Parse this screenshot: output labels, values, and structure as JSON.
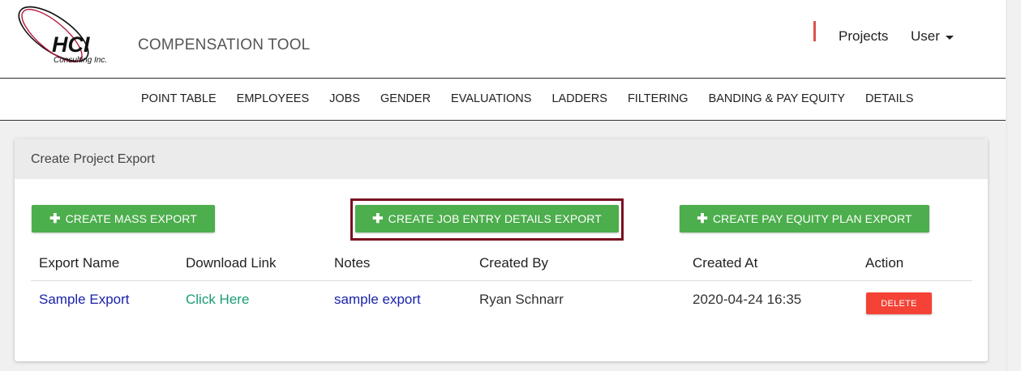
{
  "header": {
    "logo_main": "HCI",
    "logo_sub": "Consulting Inc.",
    "app_title": "COMPENSATION TOOL",
    "nav_projects": "Projects",
    "nav_user": "User"
  },
  "menu": {
    "items": [
      "POINT TABLE",
      "EMPLOYEES",
      "JOBS",
      "GENDER",
      "EVALUATIONS",
      "LADDERS",
      "FILTERING",
      "BANDING & PAY EQUITY",
      "DETAILS"
    ]
  },
  "card": {
    "title": "Create Project Export",
    "buttons": {
      "mass": "CREATE MASS EXPORT",
      "job": "CREATE JOB ENTRY DETAILS EXPORT",
      "pay": "CREATE PAY EQUITY PLAN EXPORT"
    },
    "table": {
      "headers": [
        "Export Name",
        "Download Link",
        "Notes",
        "Created By",
        "Created At",
        "Action"
      ],
      "rows": [
        {
          "export_name": "Sample Export",
          "download_link": "Click Here",
          "notes": "sample export",
          "created_by": "Ryan Schnarr",
          "created_at": "2020-04-24 16:35",
          "action": "DELETE"
        }
      ]
    }
  },
  "colors": {
    "primary_green": "#4cae4c",
    "delete_red": "#f44336",
    "highlight_border": "#7a1020",
    "accent_red": "#d9534f",
    "link_blue": "#1a22a8",
    "link_teal": "#1a9c75"
  }
}
